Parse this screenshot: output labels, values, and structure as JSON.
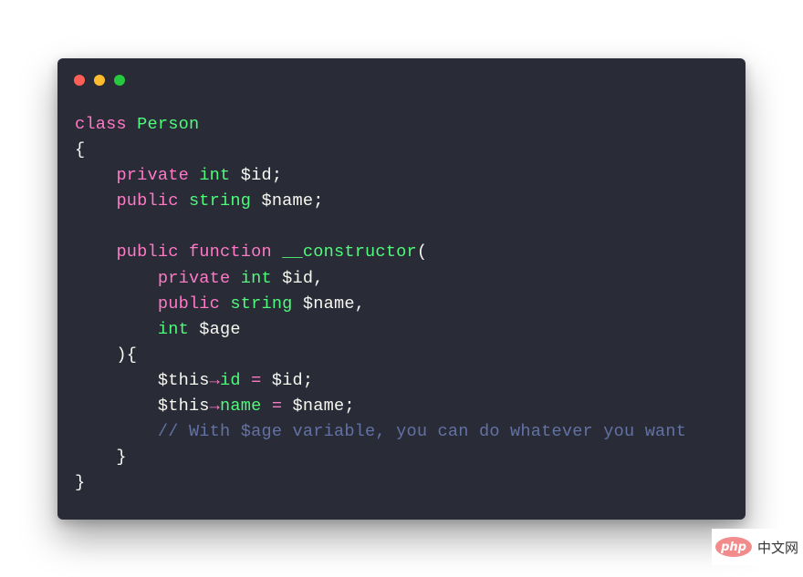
{
  "window": {
    "controls": [
      {
        "name": "close",
        "color": "#ff5f56"
      },
      {
        "name": "minimize",
        "color": "#ffbd2e"
      },
      {
        "name": "maximize",
        "color": "#27c93f"
      }
    ]
  },
  "code": {
    "language": "PHP",
    "lines": [
      [
        {
          "t": "class",
          "c": "kw"
        },
        {
          "t": " ",
          "c": "tx"
        },
        {
          "t": "Person",
          "c": "ty"
        }
      ],
      [
        {
          "t": "{",
          "c": "tx"
        }
      ],
      [
        {
          "t": "    ",
          "c": "tx"
        },
        {
          "t": "private",
          "c": "kw"
        },
        {
          "t": " ",
          "c": "tx"
        },
        {
          "t": "int",
          "c": "ty"
        },
        {
          "t": " $id;",
          "c": "tx"
        }
      ],
      [
        {
          "t": "    ",
          "c": "tx"
        },
        {
          "t": "public",
          "c": "kw"
        },
        {
          "t": " ",
          "c": "tx"
        },
        {
          "t": "string",
          "c": "ty"
        },
        {
          "t": " $name;",
          "c": "tx"
        }
      ],
      [
        {
          "t": "",
          "c": "tx"
        }
      ],
      [
        {
          "t": "    ",
          "c": "tx"
        },
        {
          "t": "public",
          "c": "kw"
        },
        {
          "t": " ",
          "c": "tx"
        },
        {
          "t": "function",
          "c": "kw"
        },
        {
          "t": " ",
          "c": "tx"
        },
        {
          "t": "__constructor",
          "c": "ty"
        },
        {
          "t": "(",
          "c": "tx"
        }
      ],
      [
        {
          "t": "        ",
          "c": "tx"
        },
        {
          "t": "private",
          "c": "kw"
        },
        {
          "t": " ",
          "c": "tx"
        },
        {
          "t": "int",
          "c": "ty"
        },
        {
          "t": " $id,",
          "c": "tx"
        }
      ],
      [
        {
          "t": "        ",
          "c": "tx"
        },
        {
          "t": "public",
          "c": "kw"
        },
        {
          "t": " ",
          "c": "tx"
        },
        {
          "t": "string",
          "c": "ty"
        },
        {
          "t": " $name,",
          "c": "tx"
        }
      ],
      [
        {
          "t": "        ",
          "c": "tx"
        },
        {
          "t": "int",
          "c": "ty"
        },
        {
          "t": " $age",
          "c": "tx"
        }
      ],
      [
        {
          "t": "    ){",
          "c": "tx"
        }
      ],
      [
        {
          "t": "        $this",
          "c": "tx"
        },
        {
          "t": "→",
          "c": "kw"
        },
        {
          "t": "id",
          "c": "ty"
        },
        {
          "t": " ",
          "c": "tx"
        },
        {
          "t": "=",
          "c": "kw"
        },
        {
          "t": " $id;",
          "c": "tx"
        }
      ],
      [
        {
          "t": "        $this",
          "c": "tx"
        },
        {
          "t": "→",
          "c": "kw"
        },
        {
          "t": "name",
          "c": "ty"
        },
        {
          "t": " ",
          "c": "tx"
        },
        {
          "t": "=",
          "c": "kw"
        },
        {
          "t": " $name;",
          "c": "tx"
        }
      ],
      [
        {
          "t": "        ",
          "c": "tx"
        },
        {
          "t": "// With $age variable, you can do whatever you want",
          "c": "cm"
        }
      ],
      [
        {
          "t": "    }",
          "c": "tx"
        }
      ],
      [
        {
          "t": "}",
          "c": "tx"
        }
      ]
    ]
  },
  "colors": {
    "background": "#292b37",
    "keyword": "#ff79c6",
    "type": "#50fa7b",
    "comment": "#6272a4",
    "text": "#f8f8f2"
  },
  "watermark": {
    "logo": "php",
    "text": "中文网"
  }
}
